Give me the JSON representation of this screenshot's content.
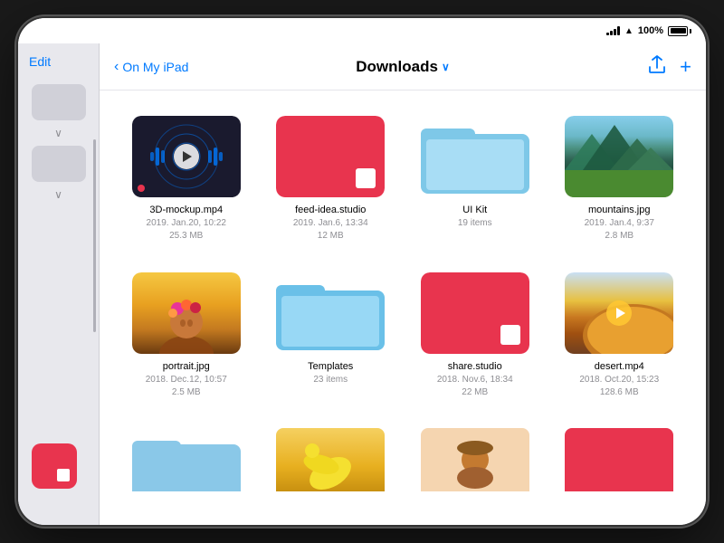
{
  "status": {
    "battery": "100%",
    "time": ""
  },
  "sidebar": {
    "edit_label": "Edit"
  },
  "navbar": {
    "back_label": "On My iPad",
    "title": "Downloads",
    "share_icon": "↑",
    "add_icon": "+"
  },
  "files": [
    {
      "name": "3D-mockup.mp4",
      "meta": "2019. Jan.20, 10:22\n25.3 MB",
      "type": "video",
      "thumb_type": "3d_video"
    },
    {
      "name": "feed-idea.studio",
      "meta": "2019. Jan.6, 13:34\n12 MB",
      "type": "studio",
      "thumb_type": "studio_red"
    },
    {
      "name": "UI Kit",
      "meta": "19 items",
      "type": "folder",
      "thumb_type": "folder_blue"
    },
    {
      "name": "mountains.jpg",
      "meta": "2019. Jan.4, 9:37\n2.8 MB",
      "type": "image",
      "thumb_type": "mountains"
    },
    {
      "name": "portrait.jpg",
      "meta": "2018. Dec.12, 10:57\n2.5 MB",
      "type": "image",
      "thumb_type": "portrait"
    },
    {
      "name": "Templates",
      "meta": "23 items",
      "type": "folder",
      "thumb_type": "folder_light_blue"
    },
    {
      "name": "share.studio",
      "meta": "2018. Nov.6, 18:34\n22 MB",
      "type": "studio",
      "thumb_type": "studio_red"
    },
    {
      "name": "desert.mp4",
      "meta": "2018. Oct.20, 15:23\n128.6 MB",
      "type": "video",
      "thumb_type": "desert"
    }
  ],
  "bottom_folders": [
    {
      "type": "light_blue"
    },
    {
      "type": "pink"
    },
    {
      "type": "peach"
    },
    {
      "type": "hot_pink"
    }
  ]
}
